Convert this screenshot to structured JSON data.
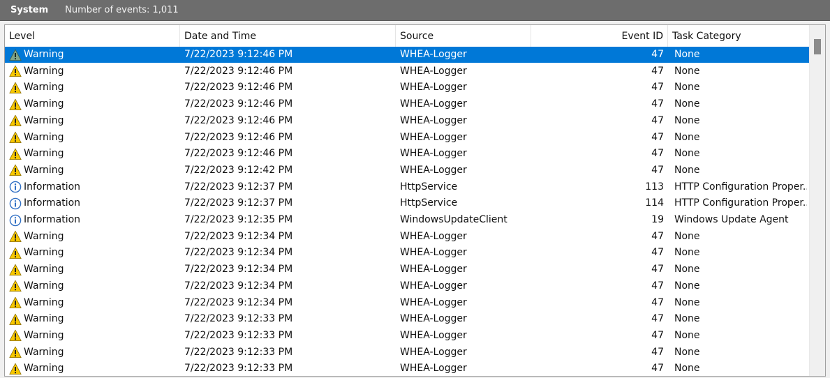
{
  "titlebar": {
    "log_name": "System",
    "event_count": "Number of events: 1,011"
  },
  "columns": [
    "Level",
    "Date and Time",
    "Source",
    "Event ID",
    "Task Category"
  ],
  "colors": {
    "selection": "#0078d7",
    "warning": "#f7c700",
    "info_border": "#2f6fc4"
  },
  "rows": [
    {
      "level": "Warning",
      "icon": "warning-icon",
      "datetime": "7/22/2023 9:12:46 PM",
      "source": "WHEA-Logger",
      "event_id": "47",
      "task": "None",
      "selected": true
    },
    {
      "level": "Warning",
      "icon": "warning-icon",
      "datetime": "7/22/2023 9:12:46 PM",
      "source": "WHEA-Logger",
      "event_id": "47",
      "task": "None"
    },
    {
      "level": "Warning",
      "icon": "warning-icon",
      "datetime": "7/22/2023 9:12:46 PM",
      "source": "WHEA-Logger",
      "event_id": "47",
      "task": "None"
    },
    {
      "level": "Warning",
      "icon": "warning-icon",
      "datetime": "7/22/2023 9:12:46 PM",
      "source": "WHEA-Logger",
      "event_id": "47",
      "task": "None"
    },
    {
      "level": "Warning",
      "icon": "warning-icon",
      "datetime": "7/22/2023 9:12:46 PM",
      "source": "WHEA-Logger",
      "event_id": "47",
      "task": "None"
    },
    {
      "level": "Warning",
      "icon": "warning-icon",
      "datetime": "7/22/2023 9:12:46 PM",
      "source": "WHEA-Logger",
      "event_id": "47",
      "task": "None"
    },
    {
      "level": "Warning",
      "icon": "warning-icon",
      "datetime": "7/22/2023 9:12:46 PM",
      "source": "WHEA-Logger",
      "event_id": "47",
      "task": "None"
    },
    {
      "level": "Warning",
      "icon": "warning-icon",
      "datetime": "7/22/2023 9:12:42 PM",
      "source": "WHEA-Logger",
      "event_id": "47",
      "task": "None"
    },
    {
      "level": "Information",
      "icon": "info-icon",
      "datetime": "7/22/2023 9:12:37 PM",
      "source": "HttpService",
      "event_id": "113",
      "task": "HTTP Configuration Proper..."
    },
    {
      "level": "Information",
      "icon": "info-icon",
      "datetime": "7/22/2023 9:12:37 PM",
      "source": "HttpService",
      "event_id": "114",
      "task": "HTTP Configuration Proper..."
    },
    {
      "level": "Information",
      "icon": "info-icon",
      "datetime": "7/22/2023 9:12:35 PM",
      "source": "WindowsUpdateClient",
      "event_id": "19",
      "task": "Windows Update Agent"
    },
    {
      "level": "Warning",
      "icon": "warning-icon",
      "datetime": "7/22/2023 9:12:34 PM",
      "source": "WHEA-Logger",
      "event_id": "47",
      "task": "None"
    },
    {
      "level": "Warning",
      "icon": "warning-icon",
      "datetime": "7/22/2023 9:12:34 PM",
      "source": "WHEA-Logger",
      "event_id": "47",
      "task": "None"
    },
    {
      "level": "Warning",
      "icon": "warning-icon",
      "datetime": "7/22/2023 9:12:34 PM",
      "source": "WHEA-Logger",
      "event_id": "47",
      "task": "None"
    },
    {
      "level": "Warning",
      "icon": "warning-icon",
      "datetime": "7/22/2023 9:12:34 PM",
      "source": "WHEA-Logger",
      "event_id": "47",
      "task": "None"
    },
    {
      "level": "Warning",
      "icon": "warning-icon",
      "datetime": "7/22/2023 9:12:34 PM",
      "source": "WHEA-Logger",
      "event_id": "47",
      "task": "None"
    },
    {
      "level": "Warning",
      "icon": "warning-icon",
      "datetime": "7/22/2023 9:12:33 PM",
      "source": "WHEA-Logger",
      "event_id": "47",
      "task": "None"
    },
    {
      "level": "Warning",
      "icon": "warning-icon",
      "datetime": "7/22/2023 9:12:33 PM",
      "source": "WHEA-Logger",
      "event_id": "47",
      "task": "None"
    },
    {
      "level": "Warning",
      "icon": "warning-icon",
      "datetime": "7/22/2023 9:12:33 PM",
      "source": "WHEA-Logger",
      "event_id": "47",
      "task": "None"
    },
    {
      "level": "Warning",
      "icon": "warning-icon",
      "datetime": "7/22/2023 9:12:33 PM",
      "source": "WHEA-Logger",
      "event_id": "47",
      "task": "None"
    }
  ]
}
